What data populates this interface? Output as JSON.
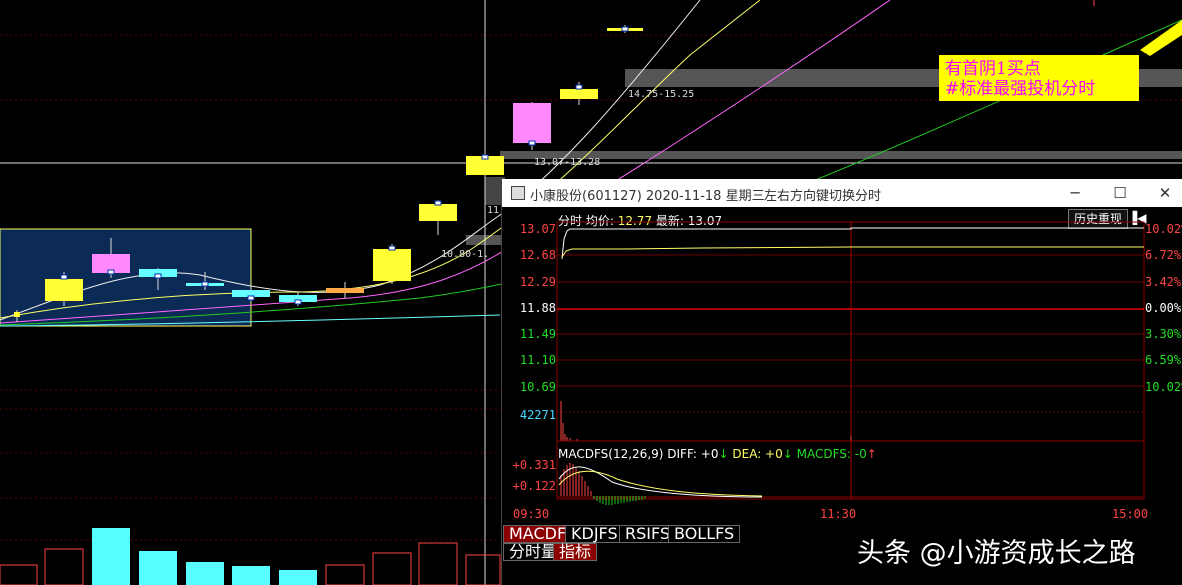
{
  "background": {
    "price_labels": [
      "14.75-15.25",
      "13.07-13.28",
      "10.80-1.",
      "11"
    ],
    "annotation": {
      "line1": "有首阴1买点",
      "line2": "#标准最强投机分时"
    }
  },
  "window": {
    "title": "小康股份(601127) 2020-11-18 星期三",
    "hint": "左右方向键切换分时",
    "minimize": "─",
    "maximize": "☐",
    "close": "✕"
  },
  "intraday": {
    "label_fenshi": "分时",
    "label_avg": "均价:",
    "avg_value": "12.77",
    "label_latest": "最新:",
    "latest_value": "13.07",
    "history_button": "历史重现",
    "y_left": [
      "13.07",
      "12.68",
      "12.29",
      "11.88",
      "11.49",
      "11.10",
      "10.69"
    ],
    "y_right": [
      "10.02%",
      "6.72%",
      "3.42%",
      "0.00%",
      "3.30%",
      "6.59%",
      "10.02%"
    ],
    "volume_label": "42271",
    "colors": {
      "up": "#ff4444",
      "down": "#22dd22",
      "flat": "#ffffff",
      "price_line": "#ffffff",
      "avg_line": "#ffff66"
    }
  },
  "macd": {
    "name": "MACDFS(12,26,9)",
    "diff_label": "DIFF: +0",
    "diff_arrow": "↓",
    "dea_label": "DEA: +0",
    "dea_arrow": "↓",
    "macd_label": "MACDFS: -0",
    "macd_arrow": "↑",
    "y_labels": [
      "+0.331",
      "+0.122"
    ]
  },
  "time_axis": [
    "09:30",
    "11:30",
    "15:00"
  ],
  "tabs": [
    "MACDFS",
    "KDJFS",
    "RSIFS",
    "BOLLFS"
  ],
  "bottom_tabs": [
    "分时量",
    "指标"
  ],
  "watermark": "头条 @小游资成长之路"
}
